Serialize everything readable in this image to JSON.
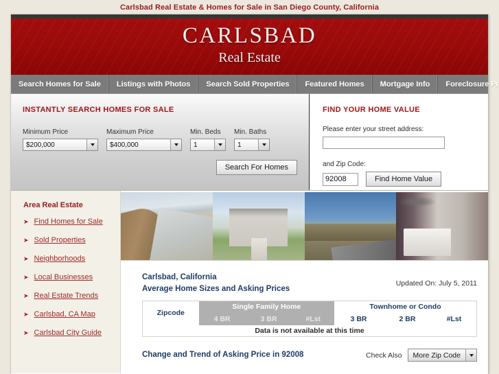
{
  "page_title": "Carlsbad Real Estate & Homes for Sale in San Diego County, California",
  "banner": {
    "title": "CARLSBAD",
    "subtitle": "Real Estate"
  },
  "nav": {
    "items": [
      {
        "label": "Search Homes for Sale"
      },
      {
        "label": "Listings with Photos"
      },
      {
        "label": "Search Sold Properties"
      },
      {
        "label": "Featured Homes"
      },
      {
        "label": "Mortgage Info"
      },
      {
        "label": "Foreclosure Properties"
      }
    ]
  },
  "search_panel": {
    "heading": "INSTANTLY SEARCH HOMES FOR SALE",
    "fields": [
      {
        "label": "Minimum Price",
        "value": "$200,000"
      },
      {
        "label": "Maximum Price",
        "value": "$400,000"
      },
      {
        "label": "Min. Beds",
        "value": "1"
      },
      {
        "label": "Min. Baths",
        "value": "1"
      }
    ],
    "submit_label": "Search For Homes"
  },
  "home_value_panel": {
    "heading": "FIND YOUR HOME VALUE",
    "address_label": "Please enter your street address:",
    "address_value": "",
    "address_placeholder": "",
    "zip_label": "and Zip Code:",
    "zip_value": "92008",
    "submit_label": "Find Home Value"
  },
  "sidebar": {
    "heading": "Area Real Estate",
    "bullet": "➤",
    "items": [
      {
        "label": "Find Homes for Sale"
      },
      {
        "label": "Sold Properties"
      },
      {
        "label": "Neighborhoods"
      },
      {
        "label": "Local Businesses"
      },
      {
        "label": "Real Estate Trends"
      },
      {
        "label": "Carlsbad, CA Map"
      },
      {
        "label": "Carlsbad City Guide"
      }
    ]
  },
  "photos": [
    {
      "name": "beach-coastline-photo"
    },
    {
      "name": "luxury-house-photo"
    },
    {
      "name": "desert-road-photo"
    },
    {
      "name": "living-room-interior-photo"
    }
  ],
  "main": {
    "location_title": "Carlsbad, California",
    "section_title": "Average Home Sizes and Asking Prices",
    "updated_on": "Updated On: July 5, 2011",
    "table": {
      "zipcode_header": "Zipcode",
      "group_single_family": "Single Family Home",
      "group_townhome_condo": "Townhome or Condo",
      "sub_headers_sfh": [
        "4 BR",
        "3 BR",
        "#Lst"
      ],
      "sub_headers_tc": [
        "3 BR",
        "2 BR",
        "#Lst"
      ],
      "no_data_message": "Data is not available at this time"
    },
    "trend_title": "Change and Trend of Asking Price in 92008",
    "check_also_label": "Check Also",
    "zip_select_value": "More Zip Code"
  },
  "colors": {
    "brand_red": "#9c1b1b",
    "banner_red": "#9b0a0a",
    "nav_gray": "#7b7b7b",
    "heading_blue": "#1f3c66",
    "page_bg": "#ece8de",
    "link_red": "#a02a2a"
  }
}
